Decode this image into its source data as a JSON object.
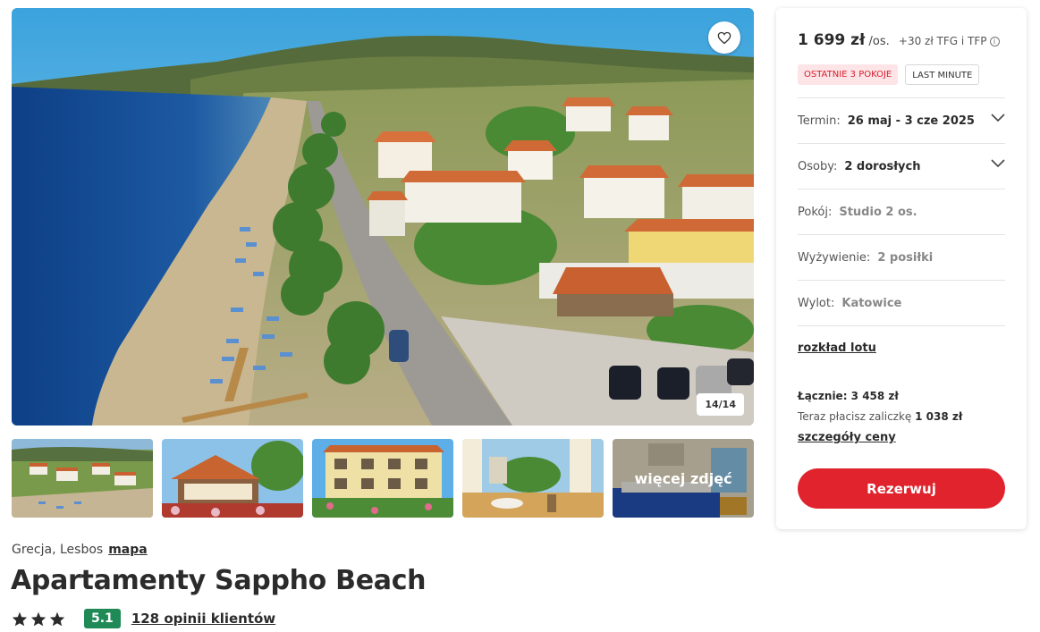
{
  "gallery": {
    "counter": "14/14",
    "favorite_icon": "heart-icon",
    "more_photos_label": "więcej zdjęć"
  },
  "hotel": {
    "location": "Grecja, Lesbos",
    "map_link": "mapa",
    "name": "Apartamenty Sappho Beach",
    "stars": 3,
    "score": "5.1",
    "reviews_link": "128 opinii klientów"
  },
  "booking": {
    "price": "1 699 zł",
    "price_unit": "/os.",
    "price_extra": "+30 zł TFG i TFP",
    "badges": [
      "OSTATNIE 3 POKOJE",
      "LAST MINUTE"
    ],
    "rows": [
      {
        "label": "Termin:",
        "value": "26 maj - 3 cze 2025",
        "has_dropdown": true
      },
      {
        "label": "Osoby:",
        "value": "2 dorosłych",
        "has_dropdown": true
      },
      {
        "label": "Pokój:",
        "value": "Studio 2 os.",
        "has_dropdown": false
      },
      {
        "label": "Wyżywienie:",
        "value": "2 posiłki",
        "has_dropdown": false
      },
      {
        "label": "Wylot:",
        "value": "Katowice",
        "has_dropdown": false
      }
    ],
    "flight_schedule_link": "rozkład lotu",
    "total": "Łącznie: 3 458 zł",
    "deposit_prefix": "Teraz płacisz zaliczkę",
    "deposit_amount": "1 038 zł",
    "price_details_link": "szczegóły ceny",
    "book_button": "Rezerwuj"
  },
  "colors": {
    "accent": "#e0232d",
    "score_green": "#1f8a55",
    "badge_red_bg": "#fde5e7",
    "badge_red_text": "#d6202e"
  }
}
